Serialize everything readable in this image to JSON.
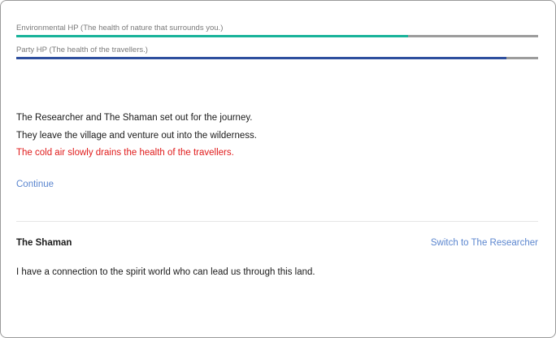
{
  "hp_bars": [
    {
      "label": "Environmental HP (The health of nature that surrounds you.)",
      "fraction": 0.75,
      "color": "#19b39a"
    },
    {
      "label": "Party HP (The health of the travellers.)",
      "fraction": 0.94,
      "color": "#2e4f9e"
    }
  ],
  "story": {
    "lines": [
      "The Researcher and The Shaman set out for the journey.",
      "They leave the village and venture out into the wilderness.",
      "The cold air slowly drains the health of the travellers."
    ],
    "warning_color": "#e01b1b"
  },
  "continue_label": "Continue",
  "character": {
    "name": "The Shaman",
    "switch_label": "Switch to The Researcher",
    "description": "I have a connection to the spirit world who can lead us through this land."
  },
  "colors": {
    "link": "#5b86cf",
    "track": "#9c9c9c"
  }
}
